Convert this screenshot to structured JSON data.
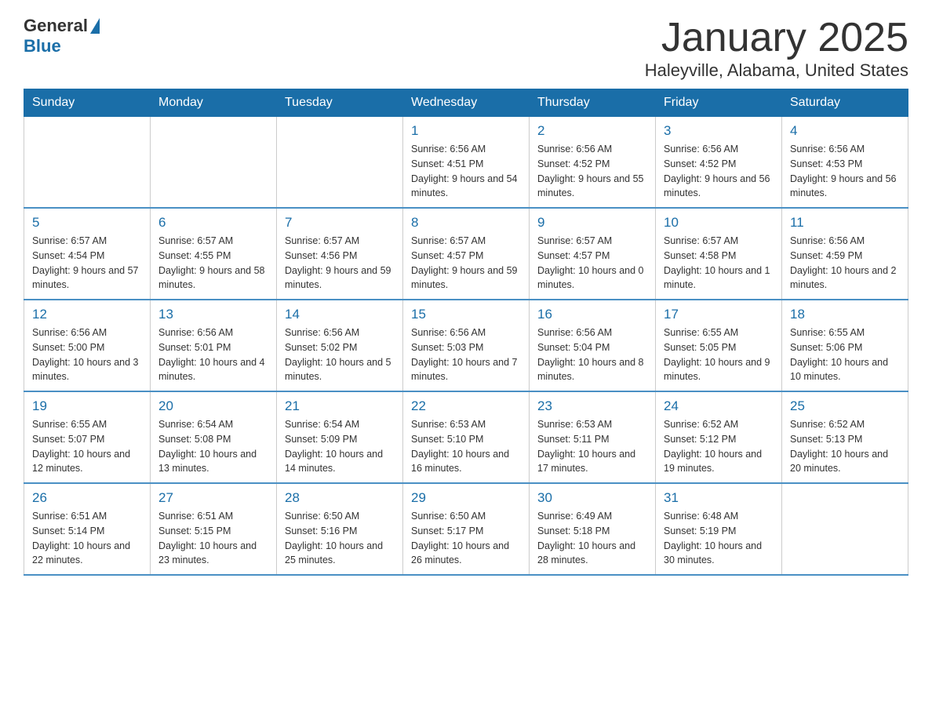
{
  "header": {
    "logo_general": "General",
    "logo_blue": "Blue",
    "title": "January 2025",
    "location": "Haleyville, Alabama, United States"
  },
  "days_of_week": [
    "Sunday",
    "Monday",
    "Tuesday",
    "Wednesday",
    "Thursday",
    "Friday",
    "Saturday"
  ],
  "weeks": [
    [
      {
        "day": "",
        "info": ""
      },
      {
        "day": "",
        "info": ""
      },
      {
        "day": "",
        "info": ""
      },
      {
        "day": "1",
        "info": "Sunrise: 6:56 AM\nSunset: 4:51 PM\nDaylight: 9 hours\nand 54 minutes."
      },
      {
        "day": "2",
        "info": "Sunrise: 6:56 AM\nSunset: 4:52 PM\nDaylight: 9 hours\nand 55 minutes."
      },
      {
        "day": "3",
        "info": "Sunrise: 6:56 AM\nSunset: 4:52 PM\nDaylight: 9 hours\nand 56 minutes."
      },
      {
        "day": "4",
        "info": "Sunrise: 6:56 AM\nSunset: 4:53 PM\nDaylight: 9 hours\nand 56 minutes."
      }
    ],
    [
      {
        "day": "5",
        "info": "Sunrise: 6:57 AM\nSunset: 4:54 PM\nDaylight: 9 hours\nand 57 minutes."
      },
      {
        "day": "6",
        "info": "Sunrise: 6:57 AM\nSunset: 4:55 PM\nDaylight: 9 hours\nand 58 minutes."
      },
      {
        "day": "7",
        "info": "Sunrise: 6:57 AM\nSunset: 4:56 PM\nDaylight: 9 hours\nand 59 minutes."
      },
      {
        "day": "8",
        "info": "Sunrise: 6:57 AM\nSunset: 4:57 PM\nDaylight: 9 hours\nand 59 minutes."
      },
      {
        "day": "9",
        "info": "Sunrise: 6:57 AM\nSunset: 4:57 PM\nDaylight: 10 hours\nand 0 minutes."
      },
      {
        "day": "10",
        "info": "Sunrise: 6:57 AM\nSunset: 4:58 PM\nDaylight: 10 hours\nand 1 minute."
      },
      {
        "day": "11",
        "info": "Sunrise: 6:56 AM\nSunset: 4:59 PM\nDaylight: 10 hours\nand 2 minutes."
      }
    ],
    [
      {
        "day": "12",
        "info": "Sunrise: 6:56 AM\nSunset: 5:00 PM\nDaylight: 10 hours\nand 3 minutes."
      },
      {
        "day": "13",
        "info": "Sunrise: 6:56 AM\nSunset: 5:01 PM\nDaylight: 10 hours\nand 4 minutes."
      },
      {
        "day": "14",
        "info": "Sunrise: 6:56 AM\nSunset: 5:02 PM\nDaylight: 10 hours\nand 5 minutes."
      },
      {
        "day": "15",
        "info": "Sunrise: 6:56 AM\nSunset: 5:03 PM\nDaylight: 10 hours\nand 7 minutes."
      },
      {
        "day": "16",
        "info": "Sunrise: 6:56 AM\nSunset: 5:04 PM\nDaylight: 10 hours\nand 8 minutes."
      },
      {
        "day": "17",
        "info": "Sunrise: 6:55 AM\nSunset: 5:05 PM\nDaylight: 10 hours\nand 9 minutes."
      },
      {
        "day": "18",
        "info": "Sunrise: 6:55 AM\nSunset: 5:06 PM\nDaylight: 10 hours\nand 10 minutes."
      }
    ],
    [
      {
        "day": "19",
        "info": "Sunrise: 6:55 AM\nSunset: 5:07 PM\nDaylight: 10 hours\nand 12 minutes."
      },
      {
        "day": "20",
        "info": "Sunrise: 6:54 AM\nSunset: 5:08 PM\nDaylight: 10 hours\nand 13 minutes."
      },
      {
        "day": "21",
        "info": "Sunrise: 6:54 AM\nSunset: 5:09 PM\nDaylight: 10 hours\nand 14 minutes."
      },
      {
        "day": "22",
        "info": "Sunrise: 6:53 AM\nSunset: 5:10 PM\nDaylight: 10 hours\nand 16 minutes."
      },
      {
        "day": "23",
        "info": "Sunrise: 6:53 AM\nSunset: 5:11 PM\nDaylight: 10 hours\nand 17 minutes."
      },
      {
        "day": "24",
        "info": "Sunrise: 6:52 AM\nSunset: 5:12 PM\nDaylight: 10 hours\nand 19 minutes."
      },
      {
        "day": "25",
        "info": "Sunrise: 6:52 AM\nSunset: 5:13 PM\nDaylight: 10 hours\nand 20 minutes."
      }
    ],
    [
      {
        "day": "26",
        "info": "Sunrise: 6:51 AM\nSunset: 5:14 PM\nDaylight: 10 hours\nand 22 minutes."
      },
      {
        "day": "27",
        "info": "Sunrise: 6:51 AM\nSunset: 5:15 PM\nDaylight: 10 hours\nand 23 minutes."
      },
      {
        "day": "28",
        "info": "Sunrise: 6:50 AM\nSunset: 5:16 PM\nDaylight: 10 hours\nand 25 minutes."
      },
      {
        "day": "29",
        "info": "Sunrise: 6:50 AM\nSunset: 5:17 PM\nDaylight: 10 hours\nand 26 minutes."
      },
      {
        "day": "30",
        "info": "Sunrise: 6:49 AM\nSunset: 5:18 PM\nDaylight: 10 hours\nand 28 minutes."
      },
      {
        "day": "31",
        "info": "Sunrise: 6:48 AM\nSunset: 5:19 PM\nDaylight: 10 hours\nand 30 minutes."
      },
      {
        "day": "",
        "info": ""
      }
    ]
  ]
}
